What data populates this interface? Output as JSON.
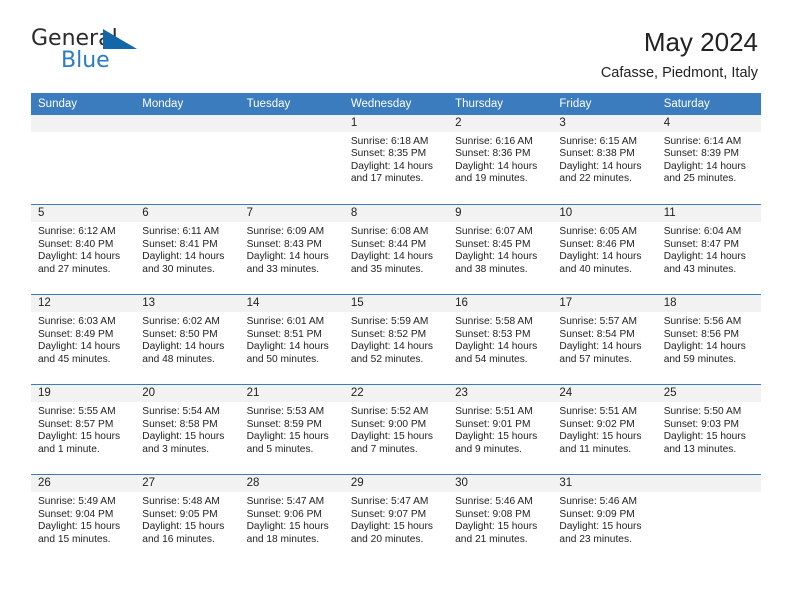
{
  "brand": {
    "name_primary": "General",
    "name_secondary": "Blue",
    "triangle_color": "#1366a8",
    "text_color": "#2b2b2b",
    "accent_color": "#2b7cc4"
  },
  "header": {
    "title": "May 2024",
    "subtitle": "Cafasse, Piedmont, Italy"
  },
  "theme": {
    "header_bar_color": "#3a7cbe",
    "header_text_color": "#ffffff",
    "daynum_band_color": "#f2f2f2",
    "row_separator_color": "#3a7cbe",
    "body_text_color": "#222222"
  },
  "weekdays": [
    "Sunday",
    "Monday",
    "Tuesday",
    "Wednesday",
    "Thursday",
    "Friday",
    "Saturday"
  ],
  "weeks": [
    [
      {
        "day": "",
        "empty": true
      },
      {
        "day": "",
        "empty": true
      },
      {
        "day": "",
        "empty": true
      },
      {
        "day": "1",
        "sunrise": "Sunrise: 6:18 AM",
        "sunset": "Sunset: 8:35 PM",
        "daylight_line1": "Daylight: 14 hours",
        "daylight_line2": "and 17 minutes."
      },
      {
        "day": "2",
        "sunrise": "Sunrise: 6:16 AM",
        "sunset": "Sunset: 8:36 PM",
        "daylight_line1": "Daylight: 14 hours",
        "daylight_line2": "and 19 minutes."
      },
      {
        "day": "3",
        "sunrise": "Sunrise: 6:15 AM",
        "sunset": "Sunset: 8:38 PM",
        "daylight_line1": "Daylight: 14 hours",
        "daylight_line2": "and 22 minutes."
      },
      {
        "day": "4",
        "sunrise": "Sunrise: 6:14 AM",
        "sunset": "Sunset: 8:39 PM",
        "daylight_line1": "Daylight: 14 hours",
        "daylight_line2": "and 25 minutes."
      }
    ],
    [
      {
        "day": "5",
        "sunrise": "Sunrise: 6:12 AM",
        "sunset": "Sunset: 8:40 PM",
        "daylight_line1": "Daylight: 14 hours",
        "daylight_line2": "and 27 minutes."
      },
      {
        "day": "6",
        "sunrise": "Sunrise: 6:11 AM",
        "sunset": "Sunset: 8:41 PM",
        "daylight_line1": "Daylight: 14 hours",
        "daylight_line2": "and 30 minutes."
      },
      {
        "day": "7",
        "sunrise": "Sunrise: 6:09 AM",
        "sunset": "Sunset: 8:43 PM",
        "daylight_line1": "Daylight: 14 hours",
        "daylight_line2": "and 33 minutes."
      },
      {
        "day": "8",
        "sunrise": "Sunrise: 6:08 AM",
        "sunset": "Sunset: 8:44 PM",
        "daylight_line1": "Daylight: 14 hours",
        "daylight_line2": "and 35 minutes."
      },
      {
        "day": "9",
        "sunrise": "Sunrise: 6:07 AM",
        "sunset": "Sunset: 8:45 PM",
        "daylight_line1": "Daylight: 14 hours",
        "daylight_line2": "and 38 minutes."
      },
      {
        "day": "10",
        "sunrise": "Sunrise: 6:05 AM",
        "sunset": "Sunset: 8:46 PM",
        "daylight_line1": "Daylight: 14 hours",
        "daylight_line2": "and 40 minutes."
      },
      {
        "day": "11",
        "sunrise": "Sunrise: 6:04 AM",
        "sunset": "Sunset: 8:47 PM",
        "daylight_line1": "Daylight: 14 hours",
        "daylight_line2": "and 43 minutes."
      }
    ],
    [
      {
        "day": "12",
        "sunrise": "Sunrise: 6:03 AM",
        "sunset": "Sunset: 8:49 PM",
        "daylight_line1": "Daylight: 14 hours",
        "daylight_line2": "and 45 minutes."
      },
      {
        "day": "13",
        "sunrise": "Sunrise: 6:02 AM",
        "sunset": "Sunset: 8:50 PM",
        "daylight_line1": "Daylight: 14 hours",
        "daylight_line2": "and 48 minutes."
      },
      {
        "day": "14",
        "sunrise": "Sunrise: 6:01 AM",
        "sunset": "Sunset: 8:51 PM",
        "daylight_line1": "Daylight: 14 hours",
        "daylight_line2": "and 50 minutes."
      },
      {
        "day": "15",
        "sunrise": "Sunrise: 5:59 AM",
        "sunset": "Sunset: 8:52 PM",
        "daylight_line1": "Daylight: 14 hours",
        "daylight_line2": "and 52 minutes."
      },
      {
        "day": "16",
        "sunrise": "Sunrise: 5:58 AM",
        "sunset": "Sunset: 8:53 PM",
        "daylight_line1": "Daylight: 14 hours",
        "daylight_line2": "and 54 minutes."
      },
      {
        "day": "17",
        "sunrise": "Sunrise: 5:57 AM",
        "sunset": "Sunset: 8:54 PM",
        "daylight_line1": "Daylight: 14 hours",
        "daylight_line2": "and 57 minutes."
      },
      {
        "day": "18",
        "sunrise": "Sunrise: 5:56 AM",
        "sunset": "Sunset: 8:56 PM",
        "daylight_line1": "Daylight: 14 hours",
        "daylight_line2": "and 59 minutes."
      }
    ],
    [
      {
        "day": "19",
        "sunrise": "Sunrise: 5:55 AM",
        "sunset": "Sunset: 8:57 PM",
        "daylight_line1": "Daylight: 15 hours",
        "daylight_line2": "and 1 minute."
      },
      {
        "day": "20",
        "sunrise": "Sunrise: 5:54 AM",
        "sunset": "Sunset: 8:58 PM",
        "daylight_line1": "Daylight: 15 hours",
        "daylight_line2": "and 3 minutes."
      },
      {
        "day": "21",
        "sunrise": "Sunrise: 5:53 AM",
        "sunset": "Sunset: 8:59 PM",
        "daylight_line1": "Daylight: 15 hours",
        "daylight_line2": "and 5 minutes."
      },
      {
        "day": "22",
        "sunrise": "Sunrise: 5:52 AM",
        "sunset": "Sunset: 9:00 PM",
        "daylight_line1": "Daylight: 15 hours",
        "daylight_line2": "and 7 minutes."
      },
      {
        "day": "23",
        "sunrise": "Sunrise: 5:51 AM",
        "sunset": "Sunset: 9:01 PM",
        "daylight_line1": "Daylight: 15 hours",
        "daylight_line2": "and 9 minutes."
      },
      {
        "day": "24",
        "sunrise": "Sunrise: 5:51 AM",
        "sunset": "Sunset: 9:02 PM",
        "daylight_line1": "Daylight: 15 hours",
        "daylight_line2": "and 11 minutes."
      },
      {
        "day": "25",
        "sunrise": "Sunrise: 5:50 AM",
        "sunset": "Sunset: 9:03 PM",
        "daylight_line1": "Daylight: 15 hours",
        "daylight_line2": "and 13 minutes."
      }
    ],
    [
      {
        "day": "26",
        "sunrise": "Sunrise: 5:49 AM",
        "sunset": "Sunset: 9:04 PM",
        "daylight_line1": "Daylight: 15 hours",
        "daylight_line2": "and 15 minutes."
      },
      {
        "day": "27",
        "sunrise": "Sunrise: 5:48 AM",
        "sunset": "Sunset: 9:05 PM",
        "daylight_line1": "Daylight: 15 hours",
        "daylight_line2": "and 16 minutes."
      },
      {
        "day": "28",
        "sunrise": "Sunrise: 5:47 AM",
        "sunset": "Sunset: 9:06 PM",
        "daylight_line1": "Daylight: 15 hours",
        "daylight_line2": "and 18 minutes."
      },
      {
        "day": "29",
        "sunrise": "Sunrise: 5:47 AM",
        "sunset": "Sunset: 9:07 PM",
        "daylight_line1": "Daylight: 15 hours",
        "daylight_line2": "and 20 minutes."
      },
      {
        "day": "30",
        "sunrise": "Sunrise: 5:46 AM",
        "sunset": "Sunset: 9:08 PM",
        "daylight_line1": "Daylight: 15 hours",
        "daylight_line2": "and 21 minutes."
      },
      {
        "day": "31",
        "sunrise": "Sunrise: 5:46 AM",
        "sunset": "Sunset: 9:09 PM",
        "daylight_line1": "Daylight: 15 hours",
        "daylight_line2": "and 23 minutes."
      },
      {
        "day": "",
        "empty": true
      }
    ]
  ]
}
